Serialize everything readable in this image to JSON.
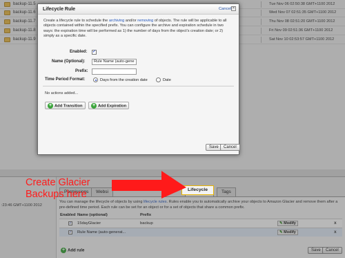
{
  "background_list": {
    "rows": [
      {
        "name": "backup-11.5",
        "date": "Tue Nov 06 02:50:38 GMT+1100 2012"
      },
      {
        "name": "backup-11.6",
        "date": "Wed Nov 07 02:51:35 GMT+1100 2012"
      },
      {
        "name": "backup-11.7",
        "date": "Thu Nov 08 02:51:20 GMT+1100 2012"
      },
      {
        "name": "backup-11.8",
        "date": "Fri Nov 09 02:51:36 GMT+1100 2012"
      },
      {
        "name": "backup-11.9",
        "date": "Sat Nov 10 02:53:57 GMT+1100 2012"
      }
    ]
  },
  "modal": {
    "title": "Lifecycle Rule",
    "cancel_link": "Cancel",
    "close_symbol": "×",
    "description_parts": [
      "Create a lifecycle rule to schedule the ",
      "archiving",
      " and/or ",
      "removing",
      " of objects. The rule will be applicable to all objects contained within the specified prefix. You can configure the archive and expiration schedule in two ways: the expiration time will be performed as 1) the number of days from the object's creation date; or 2) simply as a specific date."
    ],
    "enabled_label": "Enabled:",
    "enabled_checked": true,
    "rule_name_label": "Name (Optional):",
    "rule_name_value": "Rule Name (auto-gene",
    "prefix_label": "Prefix:",
    "prefix_value": "",
    "time_period_label": "Time Period Format:",
    "time_period_options": [
      "Days from the creation date",
      "Date"
    ],
    "time_period_selected": "Days from the creation date",
    "no_actions_text": "No actions added...",
    "add_transition_label": "Add Transition",
    "add_expiration_label": "Add Expiration",
    "save_label": "Save",
    "cancel_label": "Cancel"
  },
  "bottom_panel": {
    "left_timestamp": ":23:46 GMT+1100 2012",
    "tabs": [
      "Permissions",
      "Websi",
      "Lifecycle",
      "Tags"
    ],
    "active_tab": "Lifecycle",
    "info_parts": [
      "You can manage the lifecycle of objects by using ",
      "lifecycle rules",
      ". Rules enable you to automatically archive your objects to Amazon Glacier and remove them after a pre-defined time period. Each rule can be set for an object or for a set of objects that share a common prefix."
    ],
    "columns": [
      "Enabled",
      "Name (optional)",
      "Prefix"
    ],
    "rules": [
      {
        "enabled": true,
        "name": "15dayGlacier",
        "prefix": "backup",
        "modify": "Modify",
        "remove": "x"
      },
      {
        "enabled": true,
        "name": "Rule Name (auto-generat...",
        "prefix": "",
        "modify": "Modify",
        "remove": "x"
      }
    ],
    "add_rule_label": "Add rule",
    "save_label": "Save",
    "cancel_label": "Cancel"
  },
  "annotation": {
    "line1": "Create Glacier",
    "line2": "Backups here",
    "color": "#ff1a1a"
  }
}
